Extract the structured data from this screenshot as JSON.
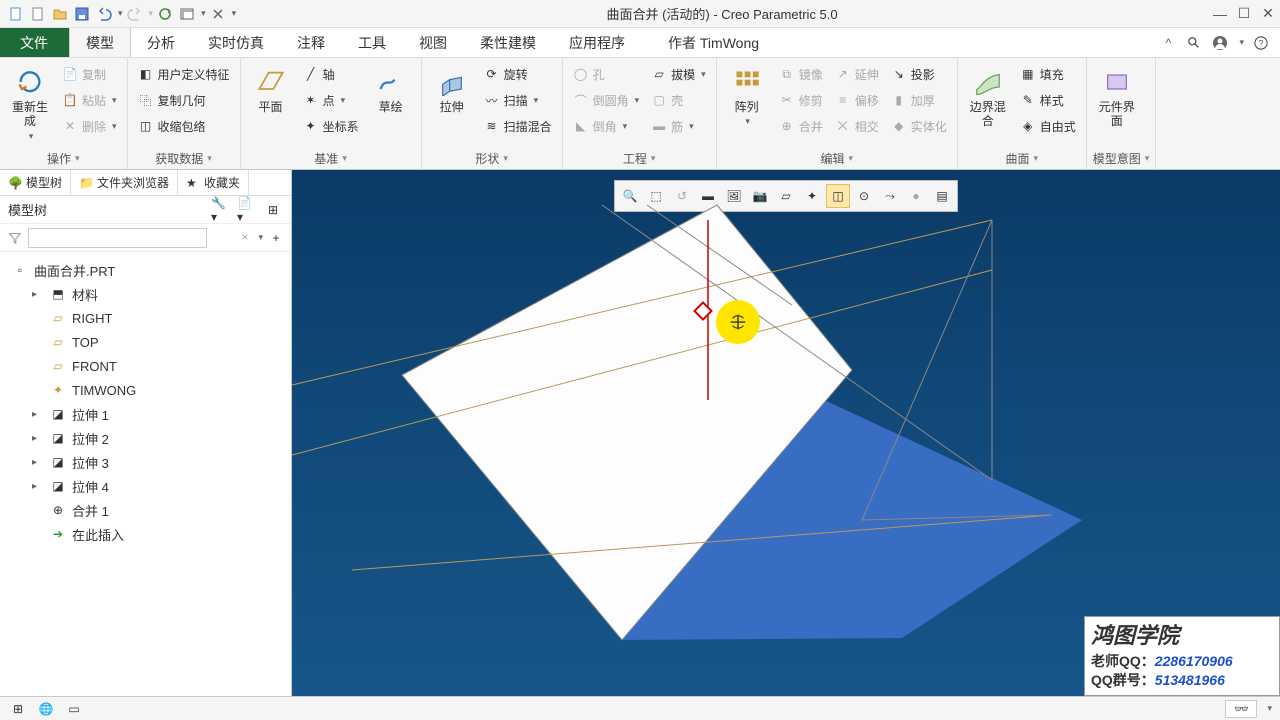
{
  "title": "曲面合并 (活动的) - Creo Parametric 5.0",
  "menu": {
    "file": "文件",
    "tabs": [
      "模型",
      "分析",
      "实时仿真",
      "注释",
      "工具",
      "视图",
      "柔性建模",
      "应用程序"
    ],
    "author_prefix": "作者",
    "author_name": "TimWong"
  },
  "ribbon": {
    "g1": {
      "regen": "重新生成",
      "copy": "复制",
      "paste": "粘贴",
      "delete": "删除",
      "label": "操作"
    },
    "g2": {
      "udf": "用户定义特征",
      "copygeo": "复制几何",
      "shrinkwrap": "收缩包络",
      "label": "获取数据"
    },
    "g3": {
      "plane": "平面",
      "sketch": "草绘",
      "axis": "轴",
      "point": "点",
      "csys": "坐标系",
      "label": "基准"
    },
    "g4": {
      "extrude": "拉伸",
      "revolve": "旋转",
      "sweep": "扫描",
      "sweepblend": "扫描混合",
      "label": "形状"
    },
    "g5": {
      "hole": "孔",
      "round": "倒圆角",
      "chamfer": "倒角",
      "draft": "拔模",
      "shell": "壳",
      "rib": "筋",
      "label": "工程"
    },
    "g6": {
      "pattern": "阵列",
      "mirror": "镜像",
      "trim": "修剪",
      "merge": "合并",
      "extend": "延伸",
      "offset": "偏移",
      "intersect": "相交",
      "thicken": "加厚",
      "solidify": "实体化",
      "project": "投影",
      "label": "编辑"
    },
    "g7": {
      "boundary": "边界混合",
      "fill": "填充",
      "style": "样式",
      "freestyle": "自由式",
      "label": "曲面"
    },
    "g8": {
      "component": "元件界面",
      "label": "模型意图"
    }
  },
  "side": {
    "tab_tree": "模型树",
    "tab_folder": "文件夹浏览器",
    "tab_fav": "收藏夹",
    "header": "模型树",
    "filter_placeholder": "",
    "root": "曲面合并.PRT",
    "items": [
      "材料",
      "RIGHT",
      "TOP",
      "FRONT",
      "TIMWONG",
      "拉伸 1",
      "拉伸 2",
      "拉伸 3",
      "拉伸 4",
      "合并 1",
      "在此插入"
    ]
  },
  "watermark": {
    "title": "鸿图学院",
    "row1_label": "老师QQ：",
    "row1_val": "2286170906",
    "row2_label": "QQ群号：",
    "row2_val": "513481966"
  }
}
